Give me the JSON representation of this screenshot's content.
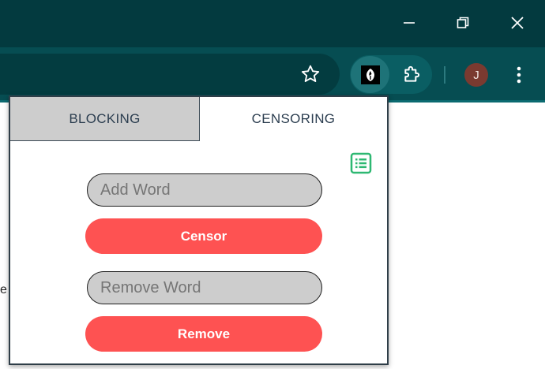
{
  "colors": {
    "titlebar": "#033a3f",
    "toolbar": "#064d52",
    "accent_button": "#fe5252",
    "list_icon": "#2eb872",
    "inactive_tab": "#cdcdcd"
  },
  "browser": {
    "icons": [
      "minimize-icon",
      "restore-icon",
      "close-icon",
      "star-icon",
      "extension-logo-icon",
      "puzzle-icon",
      "more-menu-icon"
    ],
    "avatar_initial": "J"
  },
  "page": {
    "partial_text": "e"
  },
  "popup": {
    "tabs": [
      {
        "label": "BLOCKING",
        "active": false
      },
      {
        "label": "CENSORING",
        "active": true
      }
    ],
    "add_field": {
      "placeholder": "Add Word",
      "value": ""
    },
    "censor_button": "Censor",
    "remove_field": {
      "placeholder": "Remove Word",
      "value": ""
    },
    "remove_button": "Remove"
  }
}
